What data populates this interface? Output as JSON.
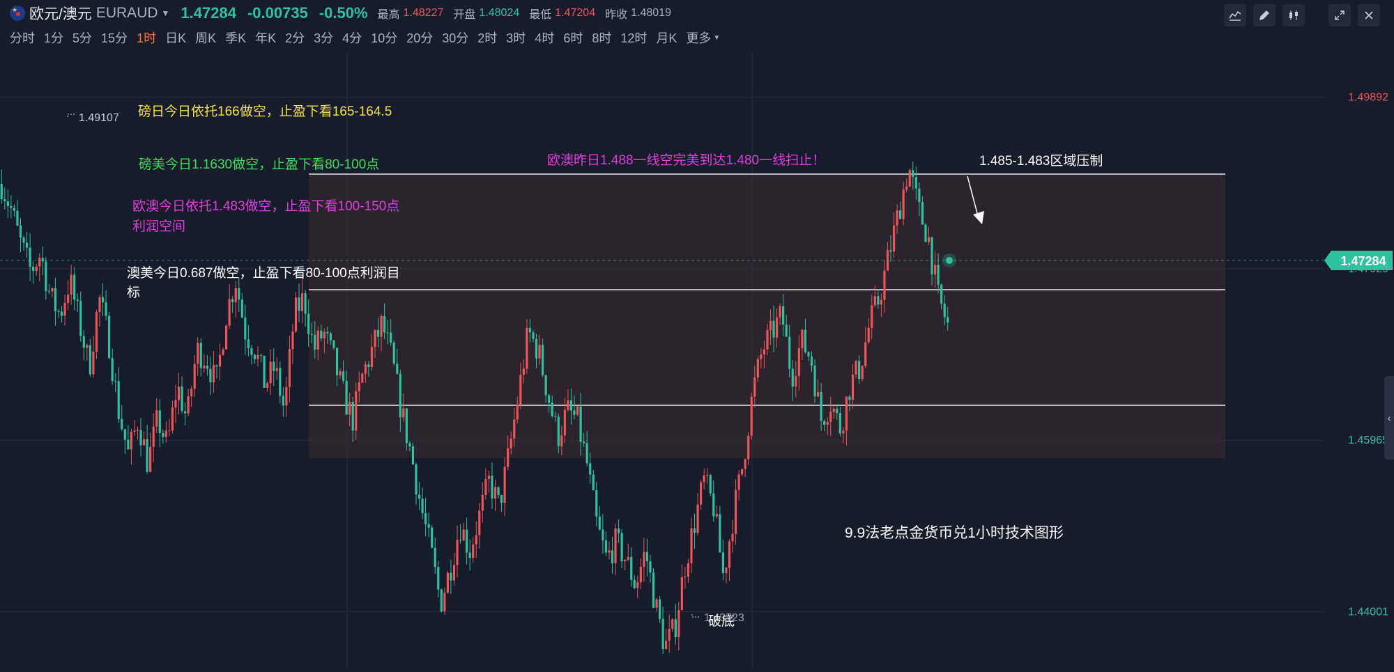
{
  "header": {
    "symbol_name": "欧元/澳元",
    "symbol_code": "EURAUD",
    "price": "1.47284",
    "change": "-0.00735",
    "change_pct": "-0.50%",
    "high_label": "最高",
    "high": "1.48227",
    "open_label": "开盘",
    "open": "1.48024",
    "low_label": "最低",
    "low": "1.47204",
    "prev_label": "昨收",
    "prev": "1.48019"
  },
  "timeframes": [
    {
      "label": "分时"
    },
    {
      "label": "1分"
    },
    {
      "label": "5分"
    },
    {
      "label": "15分"
    },
    {
      "label": "1时",
      "active": true
    },
    {
      "label": "日K"
    },
    {
      "label": "周K"
    },
    {
      "label": "季K"
    },
    {
      "label": "年K"
    },
    {
      "label": "2分"
    },
    {
      "label": "3分"
    },
    {
      "label": "4分"
    },
    {
      "label": "10分"
    },
    {
      "label": "20分"
    },
    {
      "label": "30分"
    },
    {
      "label": "2时"
    },
    {
      "label": "3时"
    },
    {
      "label": "4时"
    },
    {
      "label": "6时"
    },
    {
      "label": "8时"
    },
    {
      "label": "12时"
    },
    {
      "label": "月K"
    },
    {
      "label": "更多"
    }
  ],
  "toolbar_icons": [
    "indicator-icon",
    "draw-icon",
    "candle-style-icon",
    "expand-icon",
    "close-icon"
  ],
  "colors": {
    "up": "#f0545b",
    "down": "#2dc39e",
    "background": "#161c2a",
    "grid": "#233042"
  },
  "chart_data": {
    "type": "candlestick",
    "y_axis_labels": [
      "1.49892",
      "1.47929",
      "1.45965",
      "1.44001"
    ],
    "ylim": [
      1.4335,
      1.504
    ],
    "current_price": "1.47284",
    "high_marker": "1.49107",
    "low_marker": "1.43723",
    "close_path": [
      1.489,
      1.486,
      1.482,
      1.479,
      1.481,
      1.476,
      1.474,
      1.478,
      1.473,
      1.468,
      1.476,
      1.471,
      1.463,
      1.458,
      1.462,
      1.457,
      1.462,
      1.459,
      1.466,
      1.462,
      1.47,
      1.469,
      1.466,
      1.474,
      1.478,
      1.472,
      1.47,
      1.466,
      1.468,
      1.463,
      1.474,
      1.476,
      1.47,
      1.472,
      1.469,
      1.465,
      1.462,
      1.467,
      1.47,
      1.473,
      1.469,
      1.463,
      1.458,
      1.452,
      1.447,
      1.441,
      1.445,
      1.45,
      1.447,
      1.451,
      1.455,
      1.452,
      1.458,
      1.465,
      1.472,
      1.47,
      1.465,
      1.46,
      1.463,
      1.462,
      1.457,
      1.45,
      1.446,
      1.448,
      1.446,
      1.443,
      1.447,
      1.441,
      1.436,
      1.438,
      1.445,
      1.45,
      1.455,
      1.452,
      1.444,
      1.451,
      1.457,
      1.465,
      1.47,
      1.472,
      1.474,
      1.467,
      1.471,
      1.469,
      1.462,
      1.464,
      1.461,
      1.466,
      1.468,
      1.473,
      1.476,
      1.481,
      1.486,
      1.491,
      1.486,
      1.483,
      1.476,
      1.4728
    ],
    "annotations": {
      "text1": "磅日今日依托166做空，止盈下看165-164.5",
      "text2": "磅美今日1.1630做空，止盈下看80-100点",
      "text3_line1": "欧澳今日依托1.483做空，止盈下看100-150点",
      "text3_line2": "利润空间",
      "text4_line1": "澳美今日0.687做空，止盈下看80-100点利润目",
      "text4_line2": "标",
      "text5": "欧澳昨日1.488一线空完美到达1.480一线扫止！",
      "text6": "1.485-1.483区域压制",
      "text7": "9.9法老点金货币兑1小时技术图形",
      "text8": "破底"
    }
  }
}
